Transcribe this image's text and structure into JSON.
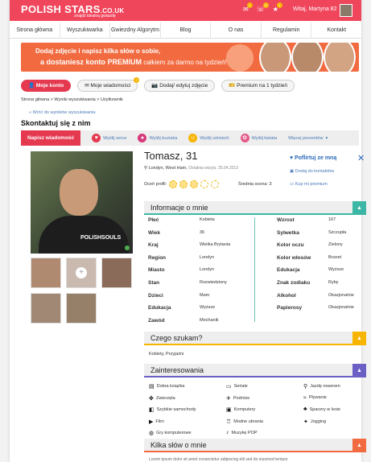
{
  "header": {
    "logo_main": "POLISH STARS",
    "logo_domain": ".CO.UK",
    "slogan": "znajdź idealną gwiazdę",
    "welcome": "Witaj, Martyna 82",
    "badges": {
      "messages": "4",
      "notifications": "13",
      "favorites": "1"
    }
  },
  "nav": [
    "Strona główna",
    "Wyszukiwarka",
    "Gwiezdny Algorytm",
    "Blog",
    "O nas",
    "Regulamin",
    "Kontakt"
  ],
  "banner": {
    "line1": "Dodaj zdjęcie i napisz kilka słów o sobie,",
    "line2a": "a dostaniesz konto PREMIUM",
    "line2b": "całkiem za darmo na tydzień!"
  },
  "buttons": {
    "my_account": "Moje konto",
    "my_messages": "Moje wiadomości",
    "messages_badge": "2",
    "add_photo": "Dodaj/ edytuj zdjęcie",
    "premium": "Premium na 1 tydzień"
  },
  "breadcrumb": "Strona główna  >  Wyniki wyszukiwania  >  Użytkownik",
  "back_link": "Wróć do wyników wyszukiwania",
  "contact_title": "Skontaktuj się z nim",
  "actions": {
    "write": "Napisz wiadomość",
    "heart": "Wyślij serce",
    "kiss": "Wyślij buziaka",
    "smile": "Wyślij uśmiech",
    "flower": "Wyślij kwiata",
    "more": "Więcej prezentów"
  },
  "profile": {
    "name": "Tomasz, 31",
    "location": "Londyn, West Ham,",
    "last_visit": "Ostatnia wizyta: 25.04.2013",
    "rate_label": "Oceń profil:",
    "avg": "Średnia ocena: 3",
    "rating": 3,
    "photo_logo": "POLISHSOULS",
    "flirt": "Poflirtuj ze mną",
    "add_contacts": "Dodaj do kontaktów",
    "buy_premium": "Kup mi premium"
  },
  "sections": {
    "about": "Informacje o mnie",
    "looking": "Czego szukam?",
    "interests": "Zainteresowania",
    "few_words": "Kilka słów o mnie"
  },
  "colors": {
    "about": "#3cb7a6",
    "looking": "#f7b500",
    "interests": "#6a5fc4",
    "few_words": "#f26a3f",
    "brand": "#f0465c"
  },
  "info_left": [
    {
      "k": "Płeć",
      "v": "Kobieta"
    },
    {
      "k": "Wiek",
      "v": "36"
    },
    {
      "k": "Kraj",
      "v": "Wielka Brytania"
    },
    {
      "k": "Region",
      "v": "Londyn"
    },
    {
      "k": "Miasto",
      "v": "Londyn"
    },
    {
      "k": "Stan",
      "v": "Rozwiedziony"
    },
    {
      "k": "Dzieci",
      "v": "Mam"
    },
    {
      "k": "Edukacja",
      "v": "Wyższe"
    },
    {
      "k": "Zawód",
      "v": "Mechanik"
    }
  ],
  "info_right": [
    {
      "k": "Wzrost",
      "v": "167"
    },
    {
      "k": "Sylwetka",
      "v": "Szczupła"
    },
    {
      "k": "Kolor oczu",
      "v": "Zielony"
    },
    {
      "k": "Kolor włosów",
      "v": "Brunet"
    },
    {
      "k": "Edukacja",
      "v": "Wyższe"
    },
    {
      "k": "Znak zodiaku",
      "v": "Ryby"
    },
    {
      "k": "Alkohol",
      "v": "Okazjonalnie"
    },
    {
      "k": "Papierosy",
      "v": "Okazjonalnie"
    }
  ],
  "looking_for": "Kobiety, Przyjaźni",
  "interests": [
    "Dobra książka",
    "Seriale",
    "Jazdę rowerem",
    "Zwierzęta",
    "Podróże",
    "Pływanie",
    "Szybkie samochody",
    "Komputery",
    "Spacery w lesie",
    "Film",
    "Modne ubrania",
    "Jogging",
    "Gry komputerowe",
    "Muzykę POP"
  ],
  "interest_icons": [
    "book-icon",
    "tv-icon",
    "bike-icon",
    "paw-icon",
    "plane-icon",
    "swim-icon",
    "car-icon",
    "computer-icon",
    "tree-icon",
    "film-icon",
    "shirt-icon",
    "run-icon",
    "gamepad-icon",
    "music-icon"
  ],
  "bottom_text": "Lorem ipsum dolor sit amet consectetur adipiscing elit sed do eiusmod tempor"
}
